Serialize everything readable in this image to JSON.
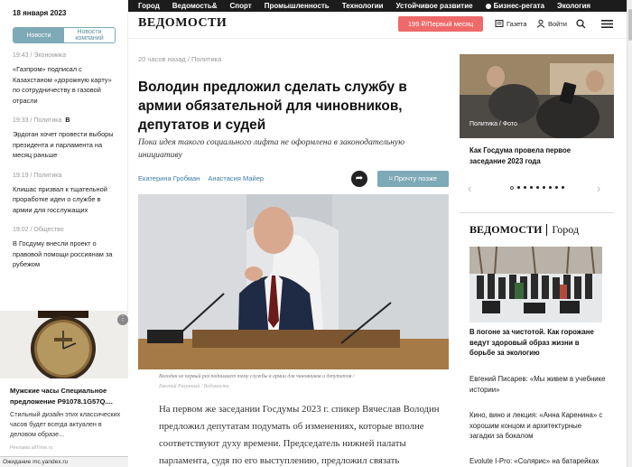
{
  "topnav": {
    "items": [
      "Город",
      "Ведомость&",
      "Спорт",
      "Промышленность",
      "Технологии",
      "Устойчивое развитие",
      "Бизнес-регата",
      "Экология"
    ]
  },
  "sidebar": {
    "date": "18 января 2023",
    "tabs": {
      "news": "Новости",
      "company_news": "Новости компаний"
    },
    "news": [
      {
        "time": "19:43",
        "section": "Экономика",
        "badge": "",
        "text": "«Газпром» подписал с Казахстаном «дорожную карту» по сотрудничеству в газовой отрасли"
      },
      {
        "time": "19:33",
        "section": "Политика",
        "badge": "B",
        "text": "Эрдоган хочет провести выборы президента и парламента на месяц раньше"
      },
      {
        "time": "19:19",
        "section": "Политика",
        "badge": "",
        "text": "Клишас призвал к тщательной проработке идеи о службе в армии для госслужащих"
      },
      {
        "time": "19:02",
        "section": "Общество",
        "badge": "",
        "text": "В Госдуму внесли проект о правовой помощи россиянам за рубежом"
      }
    ],
    "ad": {
      "title": "Мужские часы Специальное предложение P91078.1G57Q....",
      "text": "Стильный дизайн этих классических часов будет всегда актуален в деловом образе...",
      "source": "Реклама allTime.ru"
    }
  },
  "statusbar": {
    "text": "Ожидание mc.yandex.ru"
  },
  "header": {
    "logo": "ВЕДОМОСТИ",
    "subscribe": "199 ₽/Первый месяц",
    "newspaper": "Газета",
    "login": "Войти"
  },
  "article": {
    "meta": "20 часов назад / Политика",
    "title": "Володин предложил сделать службу в армии обязательной для чиновников, депутатов и судей",
    "lead": "Пока идея такого социального лифта не оформлена в законодательную инициативу",
    "authors": [
      "Екатерина Гробман",
      "Анастасия Майер"
    ],
    "read_later": "Прочту позже",
    "caption": "Володин не первый раз поднимает тему службы в армии для чиновников и депутатов /",
    "credit": "Евгений Разумный / Ведомости",
    "body": "На первом же заседании Госдумы 2023 г. спикер Вячеслав Володин предложил депутатам подумать об изменениях, которые вполне соответствуют духу времени. Председатель нижней палаты парламента, судя по его выступлению, предложил связать"
  },
  "right": {
    "photo_label": "Политика / Фото",
    "photo_title": "Как Госдума провела первое заседание 2023 года",
    "carousel": {
      "count": 9,
      "active": 0
    },
    "city_logo": "ВЕДОМОСТИ",
    "city_label": "Город",
    "city_title": "В погоне за чистотой. Как горожане ведут здоровый образ жизни в борьбе за экологию",
    "city_items": [
      "Евгений Писарев: «Мы живем в учебнике истории»",
      "Кино, вино и лекция: «Анна Каренина» с хорошим концом и архитектурные загадки за бокалом",
      "Evolute I-Pro: «Солярис» на батарейках"
    ]
  }
}
